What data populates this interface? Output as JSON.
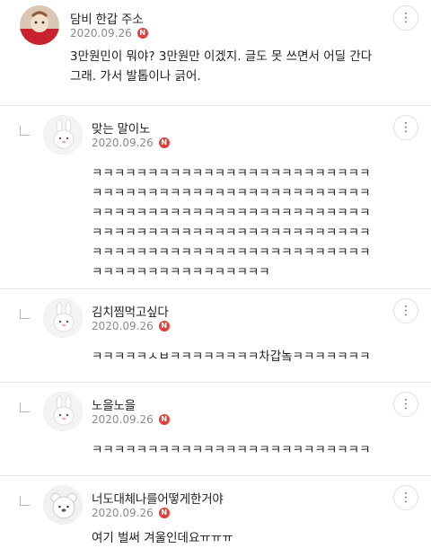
{
  "comments": [
    {
      "nick": "담비 한갑 주소",
      "date": "2020.09.26",
      "badge": "N",
      "more": "⋮",
      "lines": [
        "3만원민이 뭐야? 3만원만 이겠지. 글도 못 쓰면서 어딜 간다",
        "그래. 가서 발톱이나 긁어."
      ]
    },
    {
      "nick": "맞는 말이노",
      "date": "2020.09.26",
      "badge": "N",
      "more": "⋮",
      "lines": [
        "ㅋㅋㅋㅋㅋㅋㅋㅋㅋㅋㅋㅋㅋㅋㅋㅋㅋㅋㅋㅋㅋㅋㅋㅋㅋ",
        "ㅋㅋㅋㅋㅋㅋㅋㅋㅋㅋㅋㅋㅋㅋㅋㅋㅋㅋㅋㅋㅋㅋㅋㅋㅋ",
        "ㅋㅋㅋㅋㅋㅋㅋㅋㅋㅋㅋㅋㅋㅋㅋㅋㅋㅋㅋㅋㅋㅋㅋㅋㅋ",
        "ㅋㅋㅋㅋㅋㅋㅋㅋㅋㅋㅋㅋㅋㅋㅋㅋㅋㅋㅋㅋㅋㅋㅋㅋㅋ",
        "ㅋㅋㅋㅋㅋㅋㅋㅋㅋㅋㅋㅋㅋㅋㅋㅋㅋㅋㅋㅋㅋㅋㅋㅋㅋ",
        "ㅋㅋㅋㅋㅋㅋㅋㅋㅋㅋㅋㅋㅋㅋㅋㅋ"
      ]
    },
    {
      "nick": "김치찜먹고싶다",
      "date": "2020.09.26",
      "badge": "N",
      "more": "⋮",
      "lines": [
        "ㅋㅋㅋㅋㅋㅅㅂㅋㅋㅋㅋㅋㅋㅋㅋ차갑놐ㅋㅋㅋㅋㅋㅋㅋ"
      ]
    },
    {
      "nick": "노을노을",
      "date": "2020.09.26",
      "badge": "N",
      "more": "⋮",
      "lines": [
        "ㅋㅋㅋㅋㅋㅋㅋㅋㅋㅋㅋㅋㅋㅋㅋㅋㅋㅋㅋㅋㅋㅋㅋㅋㅋ"
      ]
    },
    {
      "nick": "너도대체나를어떻게한거야",
      "date": "2020.09.26",
      "badge": "N",
      "more": "⋮",
      "lines": [
        "여기 벌써 겨울인데요ㅠㅠㅠ"
      ]
    }
  ]
}
